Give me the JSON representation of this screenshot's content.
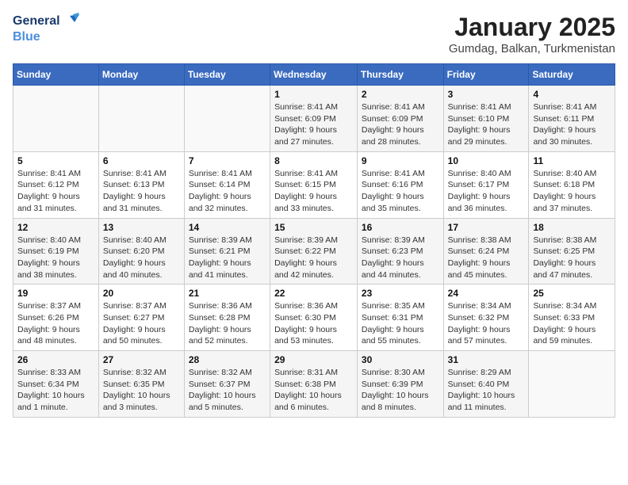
{
  "logo": {
    "line1": "General",
    "line2": "Blue"
  },
  "title": "January 2025",
  "location": "Gumdag, Balkan, Turkmenistan",
  "weekdays": [
    "Sunday",
    "Monday",
    "Tuesday",
    "Wednesday",
    "Thursday",
    "Friday",
    "Saturday"
  ],
  "weeks": [
    [
      {
        "day": "",
        "info": ""
      },
      {
        "day": "",
        "info": ""
      },
      {
        "day": "",
        "info": ""
      },
      {
        "day": "1",
        "info": "Sunrise: 8:41 AM\nSunset: 6:09 PM\nDaylight: 9 hours and 27 minutes."
      },
      {
        "day": "2",
        "info": "Sunrise: 8:41 AM\nSunset: 6:09 PM\nDaylight: 9 hours and 28 minutes."
      },
      {
        "day": "3",
        "info": "Sunrise: 8:41 AM\nSunset: 6:10 PM\nDaylight: 9 hours and 29 minutes."
      },
      {
        "day": "4",
        "info": "Sunrise: 8:41 AM\nSunset: 6:11 PM\nDaylight: 9 hours and 30 minutes."
      }
    ],
    [
      {
        "day": "5",
        "info": "Sunrise: 8:41 AM\nSunset: 6:12 PM\nDaylight: 9 hours and 31 minutes."
      },
      {
        "day": "6",
        "info": "Sunrise: 8:41 AM\nSunset: 6:13 PM\nDaylight: 9 hours and 31 minutes."
      },
      {
        "day": "7",
        "info": "Sunrise: 8:41 AM\nSunset: 6:14 PM\nDaylight: 9 hours and 32 minutes."
      },
      {
        "day": "8",
        "info": "Sunrise: 8:41 AM\nSunset: 6:15 PM\nDaylight: 9 hours and 33 minutes."
      },
      {
        "day": "9",
        "info": "Sunrise: 8:41 AM\nSunset: 6:16 PM\nDaylight: 9 hours and 35 minutes."
      },
      {
        "day": "10",
        "info": "Sunrise: 8:40 AM\nSunset: 6:17 PM\nDaylight: 9 hours and 36 minutes."
      },
      {
        "day": "11",
        "info": "Sunrise: 8:40 AM\nSunset: 6:18 PM\nDaylight: 9 hours and 37 minutes."
      }
    ],
    [
      {
        "day": "12",
        "info": "Sunrise: 8:40 AM\nSunset: 6:19 PM\nDaylight: 9 hours and 38 minutes."
      },
      {
        "day": "13",
        "info": "Sunrise: 8:40 AM\nSunset: 6:20 PM\nDaylight: 9 hours and 40 minutes."
      },
      {
        "day": "14",
        "info": "Sunrise: 8:39 AM\nSunset: 6:21 PM\nDaylight: 9 hours and 41 minutes."
      },
      {
        "day": "15",
        "info": "Sunrise: 8:39 AM\nSunset: 6:22 PM\nDaylight: 9 hours and 42 minutes."
      },
      {
        "day": "16",
        "info": "Sunrise: 8:39 AM\nSunset: 6:23 PM\nDaylight: 9 hours and 44 minutes."
      },
      {
        "day": "17",
        "info": "Sunrise: 8:38 AM\nSunset: 6:24 PM\nDaylight: 9 hours and 45 minutes."
      },
      {
        "day": "18",
        "info": "Sunrise: 8:38 AM\nSunset: 6:25 PM\nDaylight: 9 hours and 47 minutes."
      }
    ],
    [
      {
        "day": "19",
        "info": "Sunrise: 8:37 AM\nSunset: 6:26 PM\nDaylight: 9 hours and 48 minutes."
      },
      {
        "day": "20",
        "info": "Sunrise: 8:37 AM\nSunset: 6:27 PM\nDaylight: 9 hours and 50 minutes."
      },
      {
        "day": "21",
        "info": "Sunrise: 8:36 AM\nSunset: 6:28 PM\nDaylight: 9 hours and 52 minutes."
      },
      {
        "day": "22",
        "info": "Sunrise: 8:36 AM\nSunset: 6:30 PM\nDaylight: 9 hours and 53 minutes."
      },
      {
        "day": "23",
        "info": "Sunrise: 8:35 AM\nSunset: 6:31 PM\nDaylight: 9 hours and 55 minutes."
      },
      {
        "day": "24",
        "info": "Sunrise: 8:34 AM\nSunset: 6:32 PM\nDaylight: 9 hours and 57 minutes."
      },
      {
        "day": "25",
        "info": "Sunrise: 8:34 AM\nSunset: 6:33 PM\nDaylight: 9 hours and 59 minutes."
      }
    ],
    [
      {
        "day": "26",
        "info": "Sunrise: 8:33 AM\nSunset: 6:34 PM\nDaylight: 10 hours and 1 minute."
      },
      {
        "day": "27",
        "info": "Sunrise: 8:32 AM\nSunset: 6:35 PM\nDaylight: 10 hours and 3 minutes."
      },
      {
        "day": "28",
        "info": "Sunrise: 8:32 AM\nSunset: 6:37 PM\nDaylight: 10 hours and 5 minutes."
      },
      {
        "day": "29",
        "info": "Sunrise: 8:31 AM\nSunset: 6:38 PM\nDaylight: 10 hours and 6 minutes."
      },
      {
        "day": "30",
        "info": "Sunrise: 8:30 AM\nSunset: 6:39 PM\nDaylight: 10 hours and 8 minutes."
      },
      {
        "day": "31",
        "info": "Sunrise: 8:29 AM\nSunset: 6:40 PM\nDaylight: 10 hours and 11 minutes."
      },
      {
        "day": "",
        "info": ""
      }
    ]
  ]
}
